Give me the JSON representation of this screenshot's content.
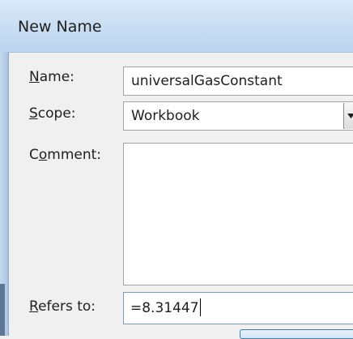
{
  "dialog": {
    "title": "New Name"
  },
  "fields": {
    "name": {
      "label_mnemonic": "N",
      "label_rest": "ame:",
      "value": "universalGasConstant"
    },
    "scope": {
      "label_mnemonic": "S",
      "label_rest": "cope:",
      "value": "Workbook"
    },
    "comment": {
      "label_pre": "C",
      "label_mnemonic": "o",
      "label_rest": "mment:",
      "value": ""
    },
    "refers_to": {
      "label_mnemonic": "R",
      "label_rest": "efers to:",
      "value": "=8.31447"
    }
  },
  "icons": {
    "scope_dropdown": "chevron-down-icon"
  },
  "colors": {
    "titlebar": "#c8ddf2",
    "frame": "#b3cbe6",
    "dialog_bg": "#f0f0f0",
    "focus_border": "#7b9bc2"
  }
}
